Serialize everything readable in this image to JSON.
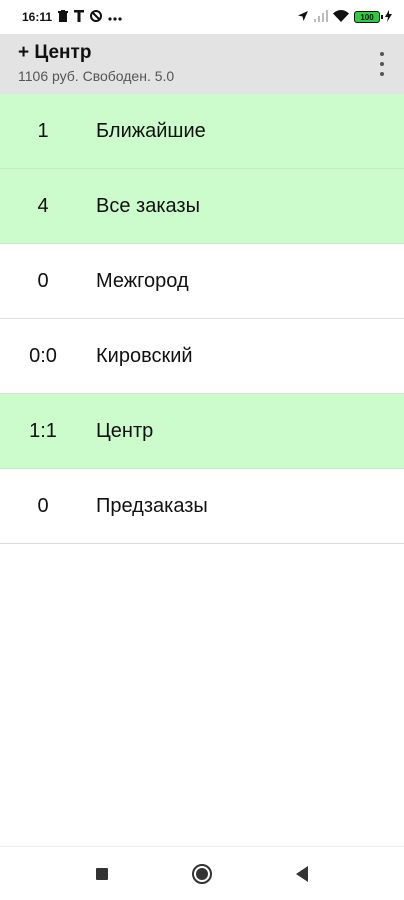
{
  "status_bar": {
    "time": "16:11",
    "icons": [
      "trash-icon",
      "t-icon",
      "no-sim-icon",
      "more-icon"
    ],
    "right_icons": [
      "location-icon",
      "signal-icon",
      "wifi-icon"
    ],
    "battery": "100"
  },
  "appbar": {
    "title": "+ Центр",
    "subtitle": "1106 руб. Свободен. 5.0",
    "menu_icon": "more-vert-icon"
  },
  "rows": [
    {
      "count": "1",
      "label": "Ближайшие",
      "highlighted": true
    },
    {
      "count": "4",
      "label": "Все заказы",
      "highlighted": true
    },
    {
      "count": "0",
      "label": "Межгород",
      "highlighted": false
    },
    {
      "count": "0:0",
      "label": "Кировский",
      "highlighted": false
    },
    {
      "count": "1:1",
      "label": "Центр",
      "highlighted": true
    },
    {
      "count": "0",
      "label": "Предзаказы",
      "highlighted": false
    }
  ],
  "navbar": {
    "icons": [
      "recents-icon",
      "home-icon",
      "back-icon"
    ]
  },
  "colors": {
    "highlight": "#ccfccc",
    "appbar": "#e3e3e3",
    "battery": "#2ecc40"
  }
}
